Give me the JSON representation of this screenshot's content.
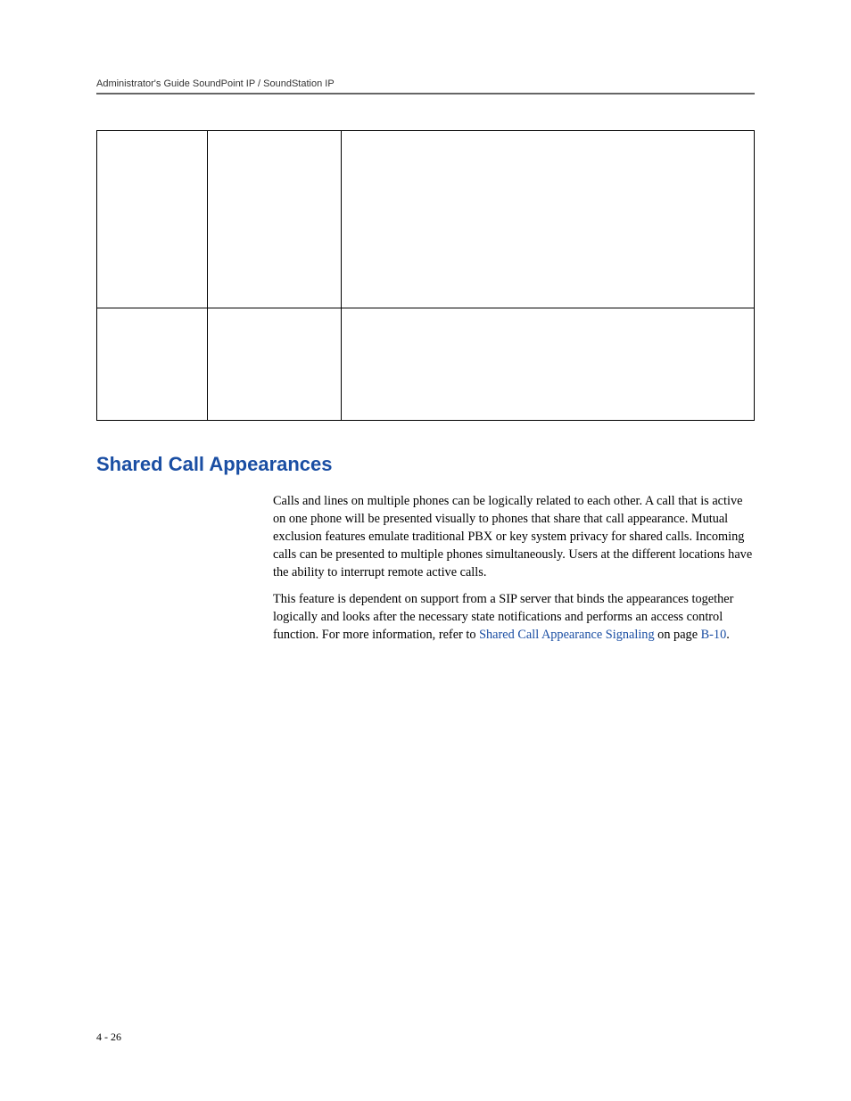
{
  "header": {
    "title": "Administrator's Guide SoundPoint IP / SoundStation IP"
  },
  "section": {
    "heading": "Shared Call Appearances",
    "paragraph1": "Calls and lines on multiple phones can be logically related to each other. A call that is active on one phone will be presented visually to phones that share that call appearance. Mutual exclusion features emulate traditional PBX or key system privacy for shared calls. Incoming calls can be presented to multiple phones simultaneously. Users at the different locations have the ability to interrupt remote active calls.",
    "paragraph2_part1": "This feature is dependent on support from a SIP server that binds the appearances together logically and looks after the necessary state notifications and performs an access control function. For more information, refer to ",
    "link1": "Shared Call Appearance Signaling",
    "paragraph2_part2": " on page ",
    "link2": "B-10",
    "paragraph2_part3": "."
  },
  "footer": {
    "page": "4 - 26"
  }
}
